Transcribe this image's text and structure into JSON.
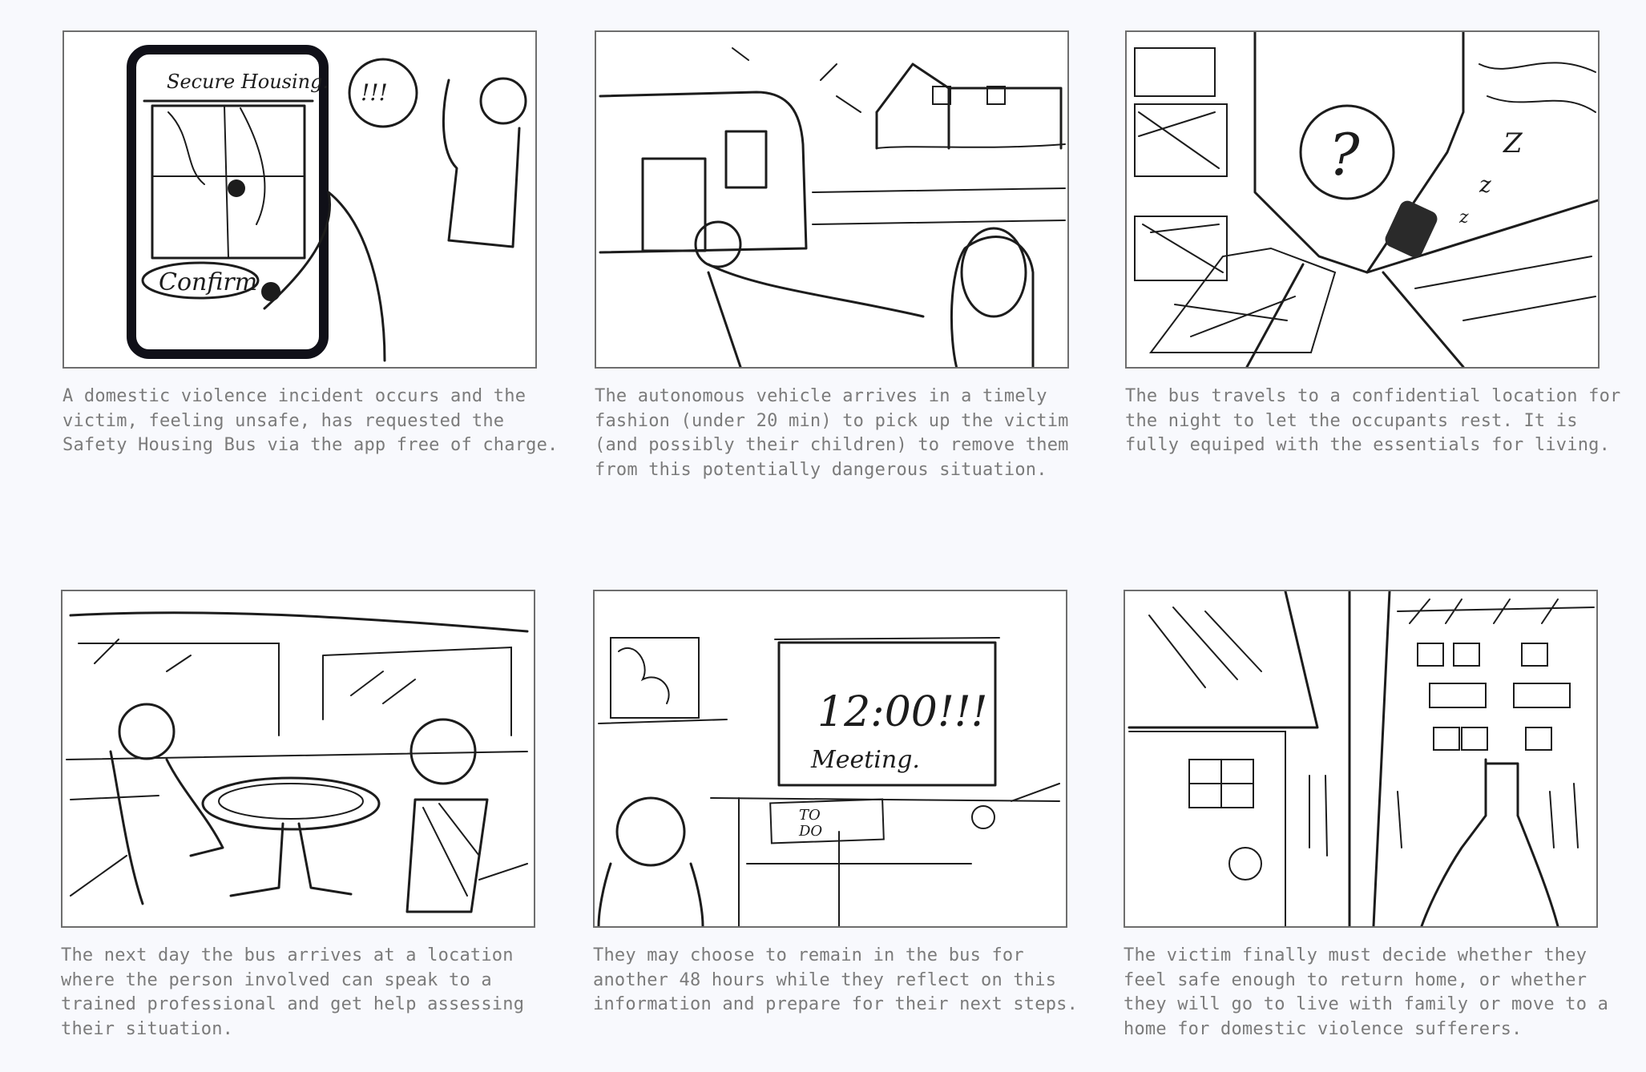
{
  "panels": [
    {
      "caption": "A domestic violence incident occurs and the victim, feeling unsafe, has requested the Safety Housing Bus via the app free of charge.",
      "sketch_text": [
        "Secure Housing.",
        "Confirm",
        "!!!"
      ]
    },
    {
      "caption": "The autonomous vehicle arrives in a timely fashion (under 20 min) to pick up the victim (and possibly their children) to remove them from this potentially dangerous situation.",
      "sketch_text": []
    },
    {
      "caption": "The bus travels to a confidential location for the night to let the occupants rest. It is fully equiped with the essentials for living.",
      "sketch_text": [
        "?",
        "Z",
        "z",
        "z"
      ]
    },
    {
      "caption": "The next day the bus arrives at a location where the person involved can speak to a trained professional and get help assessing their situation.",
      "sketch_text": []
    },
    {
      "caption": "They may choose to remain in the bus for another 48 hours while they reflect on this information and prepare for their next steps.",
      "sketch_text": [
        "12:00!!!",
        "Meeting.",
        "TO",
        "DO"
      ]
    },
    {
      "caption": "The victim finally must decide whether they feel safe enough to return home, or whether they will go to live with family or move to a home for domestic violence sufferers.",
      "sketch_text": []
    }
  ]
}
